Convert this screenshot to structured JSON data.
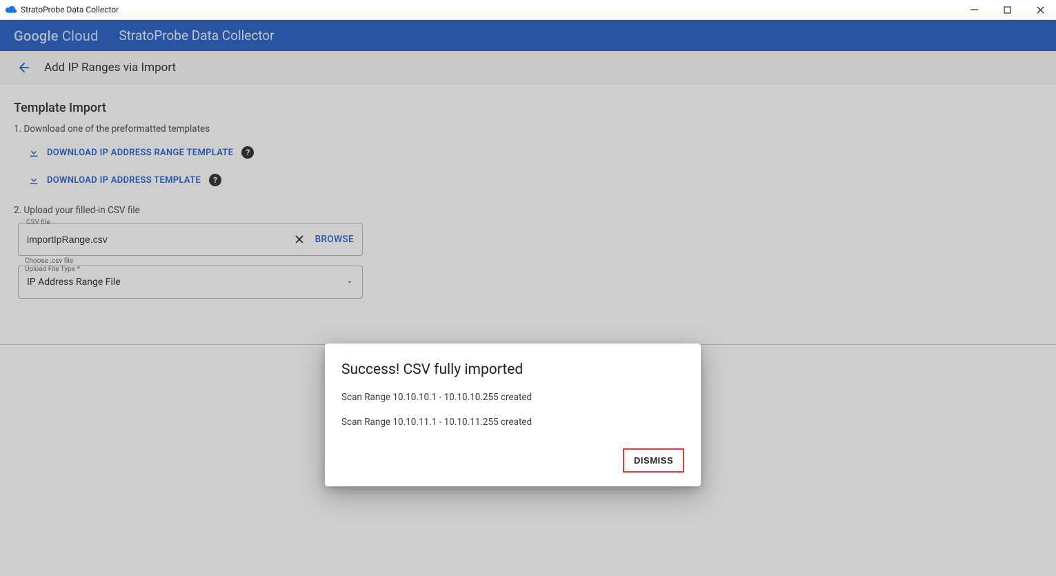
{
  "window": {
    "title": "StratoProbe Data Collector"
  },
  "topbar": {
    "brand_left": "Google",
    "brand_right": "Cloud",
    "product": "StratoProbe Data Collector"
  },
  "subheader": {
    "title": "Add IP Ranges via Import"
  },
  "template_import": {
    "heading": "Template Import",
    "step1": "1. Download one of the preformatted templates",
    "download_range_label": "DOWNLOAD IP ADDRESS RANGE TEMPLATE",
    "download_addr_label": "DOWNLOAD IP ADDRESS TEMPLATE",
    "step2": "2. Upload your filled-in CSV file",
    "csv_field_label": "CSV file",
    "csv_value": "importIpRange.csv",
    "browse_label": "BROWSE",
    "choose_hint": "Choose .csv file",
    "type_label": "Upload File Type *",
    "type_value": "IP Address Range File"
  },
  "dialog": {
    "title": "Success! CSV fully imported",
    "messages": [
      "Scan Range 10.10.10.1 - 10.10.10.255 created",
      "Scan Range 10.10.11.1 - 10.10.11.255 created"
    ],
    "dismiss_label": "DISMISS"
  }
}
